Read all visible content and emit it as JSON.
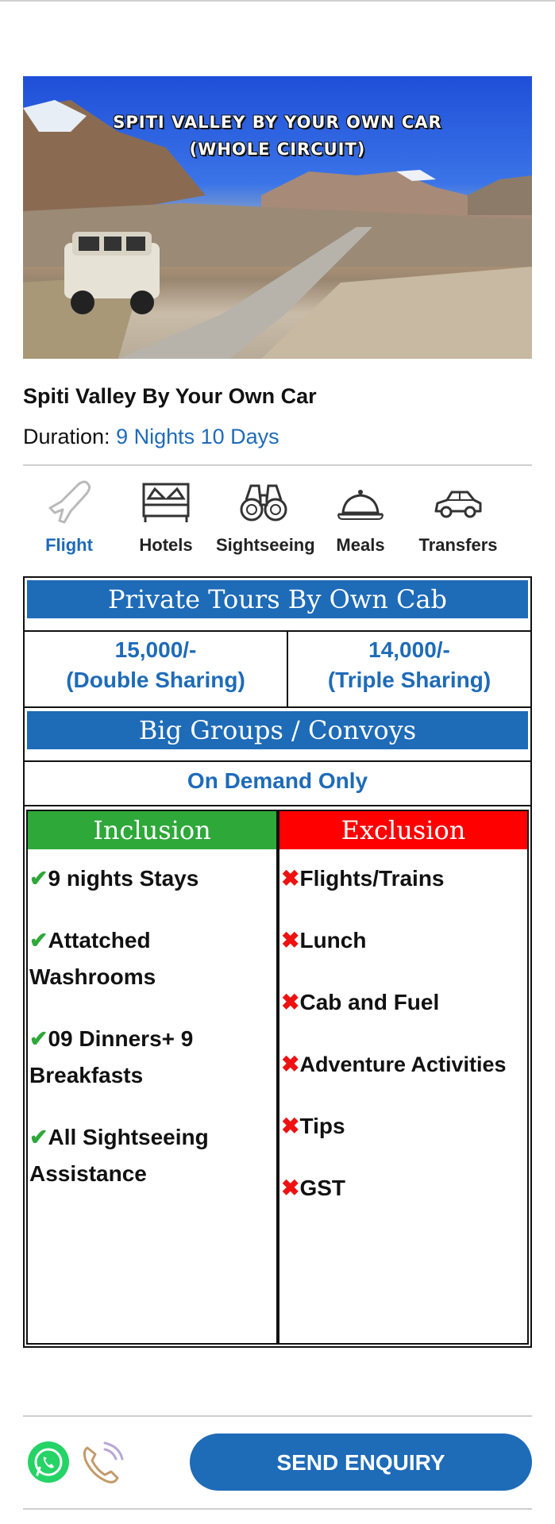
{
  "hero": {
    "title_line1": "SPITI VALLEY BY YOUR OWN CAR",
    "title_line2": "(WHOLE CIRCUIT)"
  },
  "package": {
    "title": "Spiti Valley By Your Own Car",
    "duration_label": "Duration:",
    "duration_value": "9 Nights 10 Days"
  },
  "amenities": [
    {
      "label": "Flight",
      "icon": "airplane-icon",
      "active": true
    },
    {
      "label": "Hotels",
      "icon": "bed-icon",
      "active": false
    },
    {
      "label": "Sightseeing",
      "icon": "binoculars-icon",
      "active": false
    },
    {
      "label": "Meals",
      "icon": "cloche-icon",
      "active": false
    },
    {
      "label": "Transfers",
      "icon": "car-icon",
      "active": false
    }
  ],
  "pricing": {
    "private_header": "Private Tours By Own Cab",
    "double_price": "15,000/-",
    "double_label": "(Double Sharing)",
    "triple_price": "14,000/-",
    "triple_label": "(Triple Sharing)",
    "groups_header": "Big Groups / Convoys",
    "on_demand": "On Demand Only"
  },
  "inclusion": {
    "header": "Inclusion",
    "items": [
      "9 nights Stays",
      "Attatched Washrooms",
      "09 Dinners+ 9 Breakfasts",
      "All Sightseeing Assistance"
    ]
  },
  "exclusion": {
    "header": "Exclusion",
    "items": [
      "Flights/Trains",
      "Lunch",
      "Cab and Fuel",
      "Adventure Activities",
      "Tips",
      "GST"
    ]
  },
  "footer": {
    "send_label": "SEND ENQUIRY"
  },
  "colors": {
    "accent_blue": "#1e6bb8",
    "inclusion_green": "#2fa83a",
    "exclusion_red": "#ff0000",
    "whatsapp_green": "#25d366"
  }
}
